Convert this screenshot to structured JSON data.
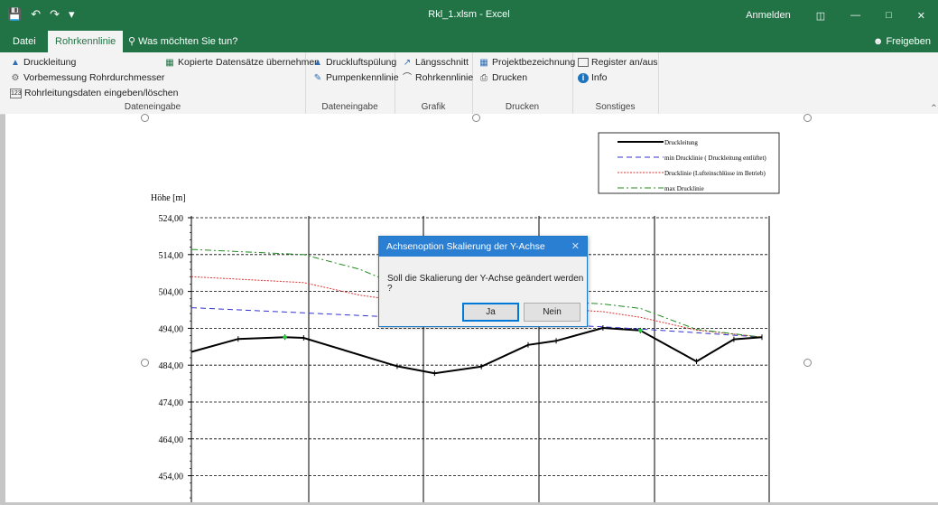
{
  "app": {
    "title": "Rkl_1.xlsm  -  Excel",
    "anmelden": "Anmelden",
    "share": "Freigeben"
  },
  "tabs": [
    {
      "label": "Datei"
    },
    {
      "label": "Rohrkennlinie"
    }
  ],
  "tell_me": "Was möchten Sie tun?",
  "ribbon": {
    "dateneingabe1": {
      "druckleitung": "Druckleitung",
      "vorbemessung": "Vorbemessung Rohrdurchmesser",
      "rohrdaten": "Rohrleitungsdaten eingeben/löschen",
      "kopierte": "Kopierte Datensätze übernehmen",
      "label": "Dateneingabe"
    },
    "dateneingabe2": {
      "druckluft": "Druckluftspülung",
      "pumpen": "Pumpenkennlinie",
      "label": "Dateneingabe"
    },
    "grafik": {
      "laengs": "Längsschnitt",
      "rohrkenn": "Rohrkennlinie",
      "label": "Grafik"
    },
    "drucken": {
      "projekt": "Projektbezeichnung",
      "drucken": "Drucken",
      "label": "Drucken"
    },
    "sonstiges": {
      "register": "Register an/aus",
      "info": "Info",
      "label": "Sonstiges"
    }
  },
  "chart_data": {
    "type": "line",
    "ylabel": "Höhe [m]",
    "ylim": [
      449.0,
      529.0
    ],
    "y_ticks": [
      "524,00",
      "514,00",
      "504,00",
      "494,00",
      "484,00",
      "474,00",
      "464,00",
      "454,00"
    ],
    "x": [
      0,
      0.5,
      1.0,
      1.2,
      2.2,
      2.5,
      3.0,
      3.5,
      4.0,
      4.1,
      4.4,
      4.8,
      5.2,
      5.6,
      5.8
    ],
    "legend": [
      "Druckleitung",
      "min Drucklinie ( Druckleitung entlüftet)",
      "Drucklinie (Lufteinschlüsse im Betrieb)",
      "max Drucklinie"
    ],
    "series": [
      {
        "name": "Druckleitung",
        "color": "#000000",
        "x": [
          0,
          0.5,
          1.0,
          1.2,
          2.2,
          2.6,
          3.1,
          3.6,
          3.9,
          4.4,
          4.8,
          5.4,
          5.8,
          6.1
        ],
        "values": [
          487.6,
          491.1,
          491.6,
          491.4,
          483.7,
          481.8,
          483.6,
          489.5,
          490.6,
          494.1,
          493.4,
          485.0,
          491.0,
          491.6
        ]
      },
      {
        "name": "min Drucklinie ( Druckleitung entlüftet)",
        "color": "#3333cc",
        "x": [
          0,
          1.2,
          2.2,
          3.0,
          4.4,
          4.8,
          5.4,
          6.1
        ],
        "values": [
          499.6,
          498.2,
          497.0,
          496.0,
          494.4,
          493.8,
          492.8,
          491.6
        ]
      },
      {
        "name": "Drucklinie (Lufteinschlüsse im Betrieb)",
        "color": "#dd3333",
        "x": [
          0,
          1.2,
          1.8,
          2.2,
          3.0,
          4.4,
          4.8,
          5.4,
          6.1
        ],
        "values": [
          508.0,
          506.4,
          503.0,
          501.6,
          500.8,
          498.5,
          497.0,
          493.5,
          491.6
        ]
      },
      {
        "name": "max Drucklinie",
        "color": "#228b22",
        "x": [
          0,
          1.2,
          1.8,
          2.2,
          3.0,
          4.4,
          4.8,
          5.4,
          6.1
        ],
        "values": [
          515.4,
          514.0,
          510.0,
          505.8,
          502.6,
          500.6,
          499.4,
          493.7,
          491.6
        ]
      }
    ],
    "markers": [
      {
        "x": 1.0,
        "y": 491.6
      },
      {
        "x": 4.8,
        "y": 493.4
      }
    ]
  },
  "dialog": {
    "title": "Achsenoption Skalierung der Y-Achse",
    "message": "Soll die Skalierung der Y-Achse geändert werden ?",
    "yes": "Ja",
    "no": "Nein"
  },
  "colors": {
    "excel_green": "#217346",
    "dialog_blue": "#2b7fd3"
  }
}
